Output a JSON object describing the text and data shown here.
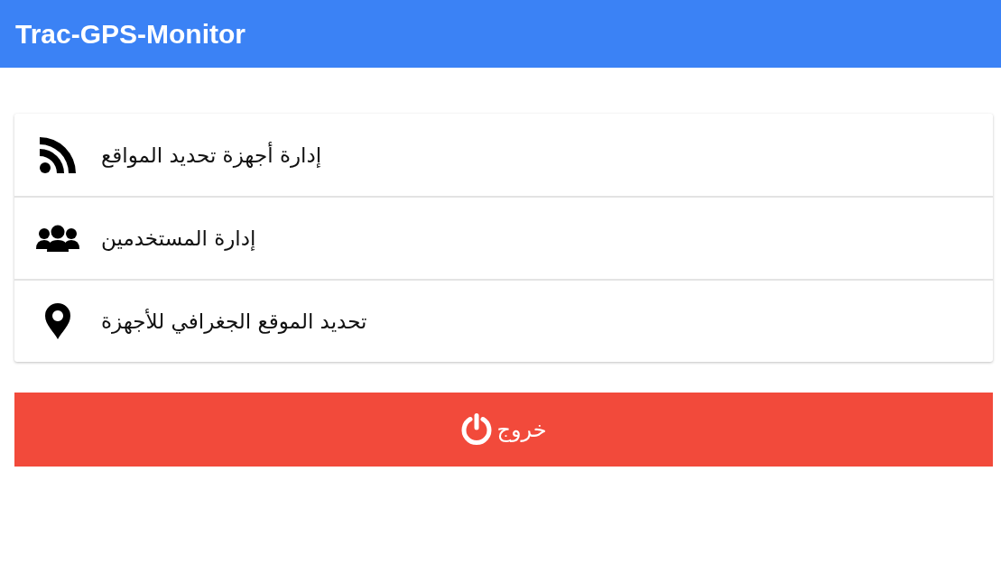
{
  "app_bar": {
    "title": "Trac-GPS-Monitor"
  },
  "menu": {
    "items": [
      {
        "kind": "feed",
        "label": "إدارة أجهزة تحديد المواقع"
      },
      {
        "kind": "users",
        "label": "إدارة المستخدمين"
      },
      {
        "kind": "pin",
        "label": "تحديد الموقع الجغرافي للأجهزة"
      }
    ]
  },
  "logout_button": {
    "label": "خروج"
  }
}
